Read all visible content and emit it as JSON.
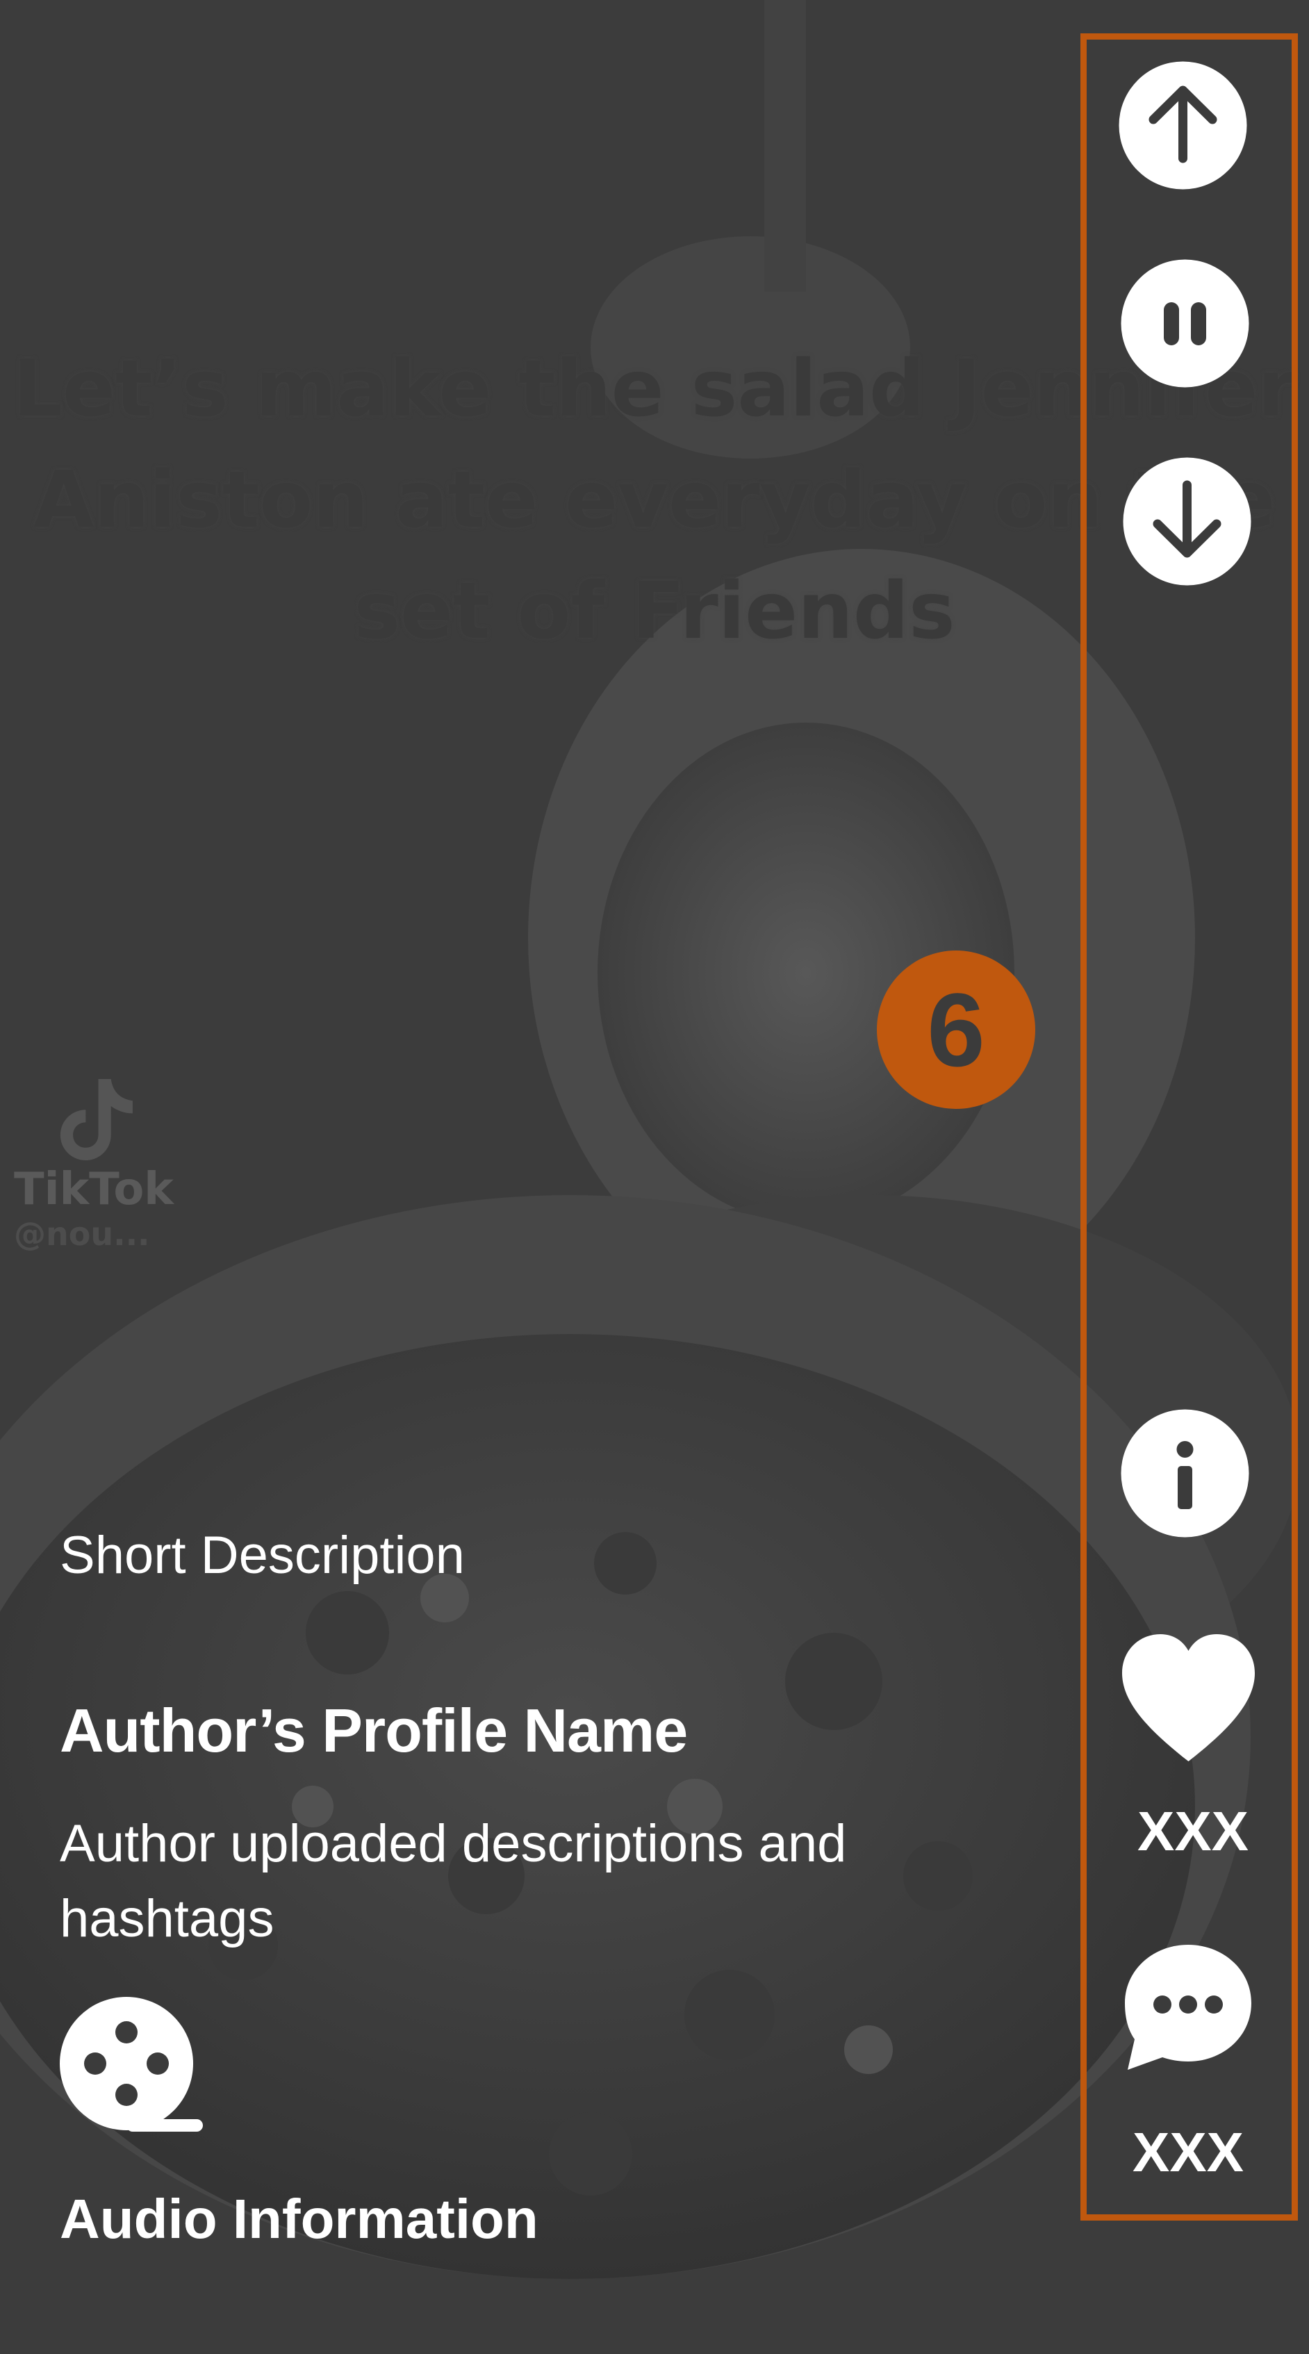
{
  "video_overlay": {
    "caption_lines": [
      "Let’s make the salad Jennifer",
      "Aniston ate everyday on the",
      "set of Friends"
    ],
    "watermark_brand": "TikTok",
    "watermark_handle": "@nou..."
  },
  "details": {
    "short_description": "Short Description",
    "author_name": "Author’s Profile Name",
    "author_description": "Author uploaded descriptions and hashtags",
    "audio_information": "Audio Information"
  },
  "controls": {
    "up": {
      "icon": "arrow-up-icon"
    },
    "pause": {
      "icon": "pause-icon"
    },
    "down": {
      "icon": "arrow-down-icon"
    },
    "info": {
      "icon": "info-icon"
    },
    "like": {
      "icon": "heart-icon",
      "count": "XXX"
    },
    "comment": {
      "icon": "comment-icon",
      "count": "XXX"
    }
  },
  "annotation": {
    "number": "6",
    "color": "#c0580e"
  },
  "colors": {
    "background": "#3b3b3b",
    "text": "#ffffff",
    "accent": "#c0580e"
  }
}
